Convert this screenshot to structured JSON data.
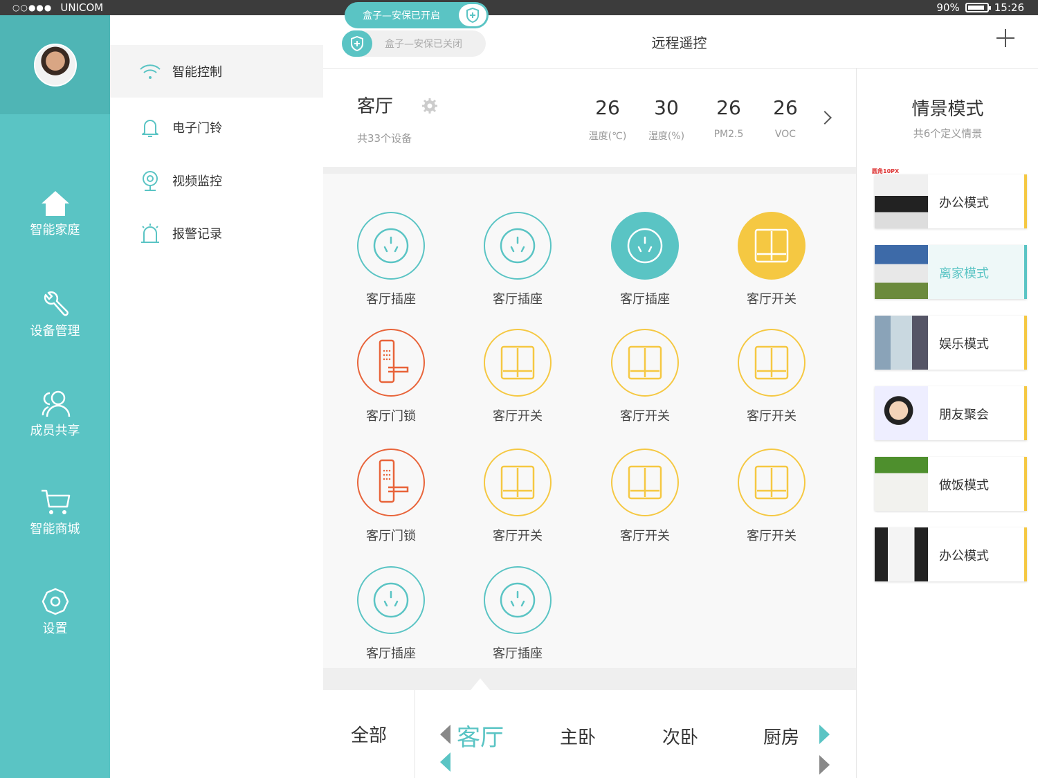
{
  "status_bar": {
    "signal": "○○●●●",
    "carrier": "UNICOM",
    "battery": "90%",
    "battery_level": 0.9,
    "time": "15:26"
  },
  "left_nav": {
    "items": [
      {
        "label": "智能家庭",
        "icon": "home-icon"
      },
      {
        "label": "设备管理",
        "icon": "wrench-icon"
      },
      {
        "label": "成员共享",
        "icon": "members-icon"
      },
      {
        "label": "智能商城",
        "icon": "cart-icon"
      },
      {
        "label": "设置",
        "icon": "settings-icon"
      }
    ]
  },
  "submenu": {
    "items": [
      {
        "label": "智能控制",
        "icon": "wifi-icon"
      },
      {
        "label": "电子门铃",
        "icon": "bell-icon"
      },
      {
        "label": "视频监控",
        "icon": "camera-icon"
      },
      {
        "label": "报警记录",
        "icon": "alarm-icon"
      }
    ]
  },
  "header": {
    "title": "远程遥控",
    "security_on": "盒子—安保已开启",
    "security_off": "盒子—安保已关闭"
  },
  "room": {
    "name": "客厅",
    "device_count": "共33个设备",
    "stats": [
      {
        "value": "26",
        "label": "温度(℃)"
      },
      {
        "value": "30",
        "label": "湿度(%)"
      },
      {
        "value": "26",
        "label": "PM2.5"
      },
      {
        "value": "26",
        "label": "VOC"
      }
    ]
  },
  "devices": [
    {
      "label": "客厅插座",
      "type": "socket",
      "state": "off"
    },
    {
      "label": "客厅插座",
      "type": "socket",
      "state": "off"
    },
    {
      "label": "客厅插座",
      "type": "socket",
      "state": "on"
    },
    {
      "label": "客厅开关",
      "type": "switch",
      "state": "on"
    },
    {
      "label": "客厅门锁",
      "type": "lock",
      "state": "off"
    },
    {
      "label": "客厅开关",
      "type": "switch",
      "state": "off"
    },
    {
      "label": "客厅开关",
      "type": "switch",
      "state": "off"
    },
    {
      "label": "客厅开关",
      "type": "switch",
      "state": "off"
    },
    {
      "label": "客厅门锁",
      "type": "lock",
      "state": "off"
    },
    {
      "label": "客厅开关",
      "type": "switch",
      "state": "off"
    },
    {
      "label": "客厅开关",
      "type": "switch",
      "state": "off"
    },
    {
      "label": "客厅开关",
      "type": "switch",
      "state": "off"
    },
    {
      "label": "客厅插座",
      "type": "socket",
      "state": "off"
    },
    {
      "label": "客厅插座",
      "type": "socket",
      "state": "off"
    }
  ],
  "room_tabs": {
    "all": "全部",
    "items": [
      "客厅",
      "主卧",
      "次卧",
      "厨房"
    ],
    "active": "客厅"
  },
  "scenes": {
    "title": "情景模式",
    "subtitle": "共6个定义情景",
    "note": "圆角10PX",
    "items": [
      {
        "label": "办公模式",
        "active": false
      },
      {
        "label": "离家模式",
        "active": true
      },
      {
        "label": "娱乐模式",
        "active": false
      },
      {
        "label": "朋友聚会",
        "active": false
      },
      {
        "label": "做饭模式",
        "active": false
      },
      {
        "label": "办公模式",
        "active": false
      }
    ]
  },
  "colors": {
    "teal": "#5ac4c4",
    "yellow": "#f5c842",
    "orange": "#e8643a"
  }
}
